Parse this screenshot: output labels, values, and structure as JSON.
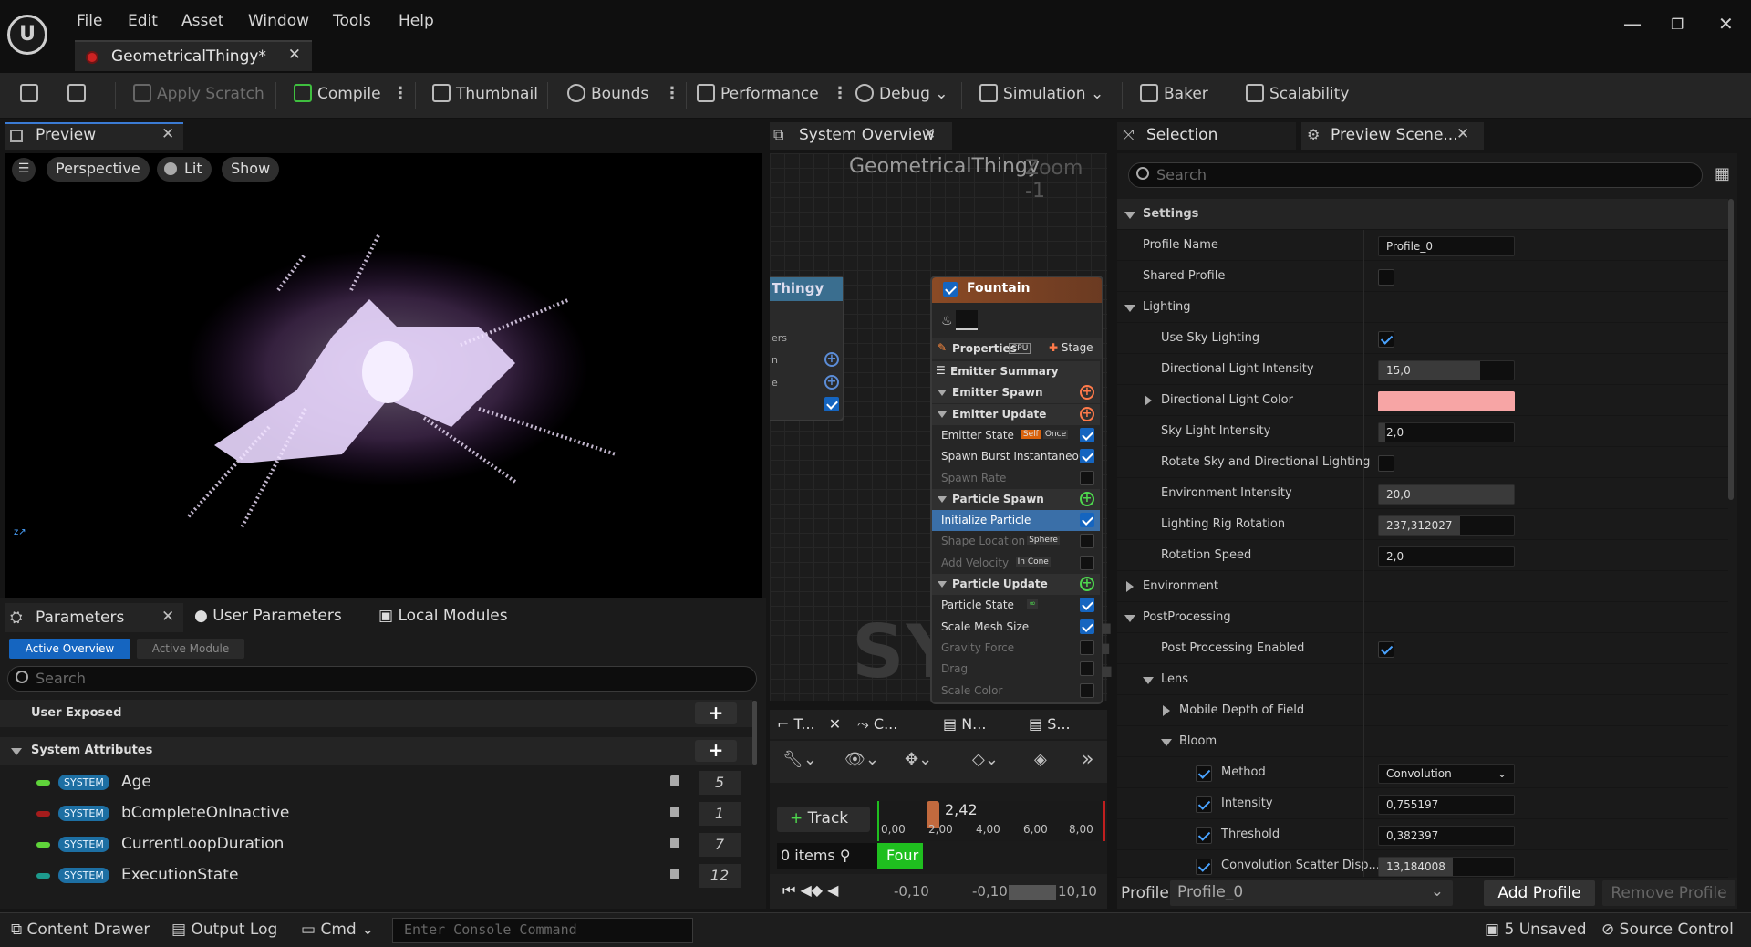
{
  "menu": [
    "File",
    "Edit",
    "Asset",
    "Window",
    "Tools",
    "Help"
  ],
  "document_tab": "GeometricalThingy*",
  "toolbar": {
    "apply_scratch": "Apply Scratch",
    "compile": "Compile",
    "thumbnail": "Thumbnail",
    "bounds": "Bounds",
    "performance": "Performance",
    "debug": "Debug",
    "simulation": "Simulation",
    "baker": "Baker",
    "scalability": "Scalability"
  },
  "preview": {
    "tab": "Preview",
    "perspective": "Perspective",
    "lit": "Lit",
    "show": "Show"
  },
  "parameters": {
    "tabs": [
      "Parameters",
      "User Parameters",
      "Local Modules"
    ],
    "active_overview": "Active Overview",
    "active_module": "Active Module",
    "search_placeholder": "Search",
    "user_exposed": "User Exposed",
    "system_attributes": "System Attributes",
    "badge": "SYSTEM",
    "attributes": [
      {
        "name": "Age",
        "value": "5",
        "color": "#5fd33a"
      },
      {
        "name": "bCompleteOnInactive",
        "value": "1",
        "color": "#a51c1c"
      },
      {
        "name": "CurrentLoopDuration",
        "value": "7",
        "color": "#5fd33a"
      },
      {
        "name": "ExecutionState",
        "value": "12",
        "color": "#1d9a8d"
      }
    ]
  },
  "system_overview": {
    "tab": "System Overview",
    "title": "GeometricalThingy",
    "zoom": "Zoom -1",
    "system_node_title": "Thingy",
    "system_node_rows": [
      "ers",
      "n",
      "e"
    ],
    "watermark": "SYSTEM",
    "emitter": {
      "title": "Fountain",
      "properties": "Properties",
      "cpu": "CPU",
      "stage": "Stage",
      "rows": [
        {
          "label": "Emitter Summary",
          "type": "header"
        },
        {
          "label": "Emitter Spawn",
          "type": "group",
          "plus": "orange"
        },
        {
          "label": "Emitter Update",
          "type": "group",
          "plus": "orange"
        },
        {
          "label": "Emitter State",
          "type": "item",
          "checked": true,
          "tag": "Self",
          "tag2": "Once"
        },
        {
          "label": "Spawn Burst Instantaneous",
          "type": "item",
          "checked": true
        },
        {
          "label": "Spawn Rate",
          "type": "item-dim",
          "checked": false
        },
        {
          "label": "Particle Spawn",
          "type": "group",
          "plus": "green"
        },
        {
          "label": "Initialize Particle",
          "type": "item-sel",
          "checked": true
        },
        {
          "label": "Shape Location",
          "type": "item-dim",
          "checked": false,
          "tag": "Sphere"
        },
        {
          "label": "Add Velocity",
          "type": "item-dim",
          "checked": false,
          "tag": "In Cone"
        },
        {
          "label": "Particle Update",
          "type": "group",
          "plus": "green"
        },
        {
          "label": "Particle State",
          "type": "item",
          "checked": true,
          "tag": "∞"
        },
        {
          "label": "Scale Mesh Size",
          "type": "item",
          "checked": true
        },
        {
          "label": "Gravity Force",
          "type": "item-dim",
          "checked": false
        },
        {
          "label": "Drag",
          "type": "item-dim",
          "checked": false
        },
        {
          "label": "Scale Color",
          "type": "item-dim",
          "checked": false
        }
      ]
    }
  },
  "timeline": {
    "tabs": [
      "T...",
      "C...",
      "N...",
      "S..."
    ],
    "track": "Track",
    "current_time": "2,42",
    "ticks": [
      "0,00",
      "2,00",
      "4,00",
      "6,00",
      "8,00"
    ],
    "items": "0 items",
    "four": "Four",
    "range_a": "-0,10",
    "range_b": "-0,10",
    "range_c": "10,10"
  },
  "details": {
    "tabs": [
      "Selection",
      "Preview Scene..."
    ],
    "search_placeholder": "Search",
    "settings": "Settings",
    "profile_name_label": "Profile Name",
    "profile_name": "Profile_0",
    "shared_profile": "Shared Profile",
    "lighting": "Lighting",
    "use_sky_lighting": "Use Sky Lighting",
    "dir_light_intensity": "Directional Light Intensity",
    "dir_light_intensity_val": "15,0",
    "dir_light_color": "Directional Light Color",
    "dir_light_color_val": "#f7a5a5",
    "sky_light_intensity": "Sky Light Intensity",
    "sky_light_intensity_val": "2,0",
    "rotate_sky": "Rotate Sky and Directional Lighting",
    "env_intensity": "Environment Intensity",
    "env_intensity_val": "20,0",
    "rig_rotation": "Lighting Rig Rotation",
    "rig_rotation_val": "237,312027",
    "rotation_speed": "Rotation Speed",
    "rotation_speed_val": "2,0",
    "environment": "Environment",
    "postprocessing": "PostProcessing",
    "pp_enabled": "Post Processing Enabled",
    "lens": "Lens",
    "mobile_dof": "Mobile Depth of Field",
    "bloom": "Bloom",
    "method": "Method",
    "method_val": "Convolution",
    "intensity": "Intensity",
    "intensity_val": "0,755197",
    "threshold": "Threshold",
    "threshold_val": "0,382397",
    "scatter": "Convolution Scatter Disp...",
    "scatter_val": "13,184008",
    "profile_label": "Profile",
    "profile_select": "Profile_0",
    "add_profile": "Add Profile",
    "remove_profile": "Remove Profile"
  },
  "status": {
    "content_drawer": "Content Drawer",
    "output_log": "Output Log",
    "cmd": "Cmd",
    "console_placeholder": "Enter Console Command",
    "unsaved": "5 Unsaved",
    "source_control": "Source Control"
  }
}
